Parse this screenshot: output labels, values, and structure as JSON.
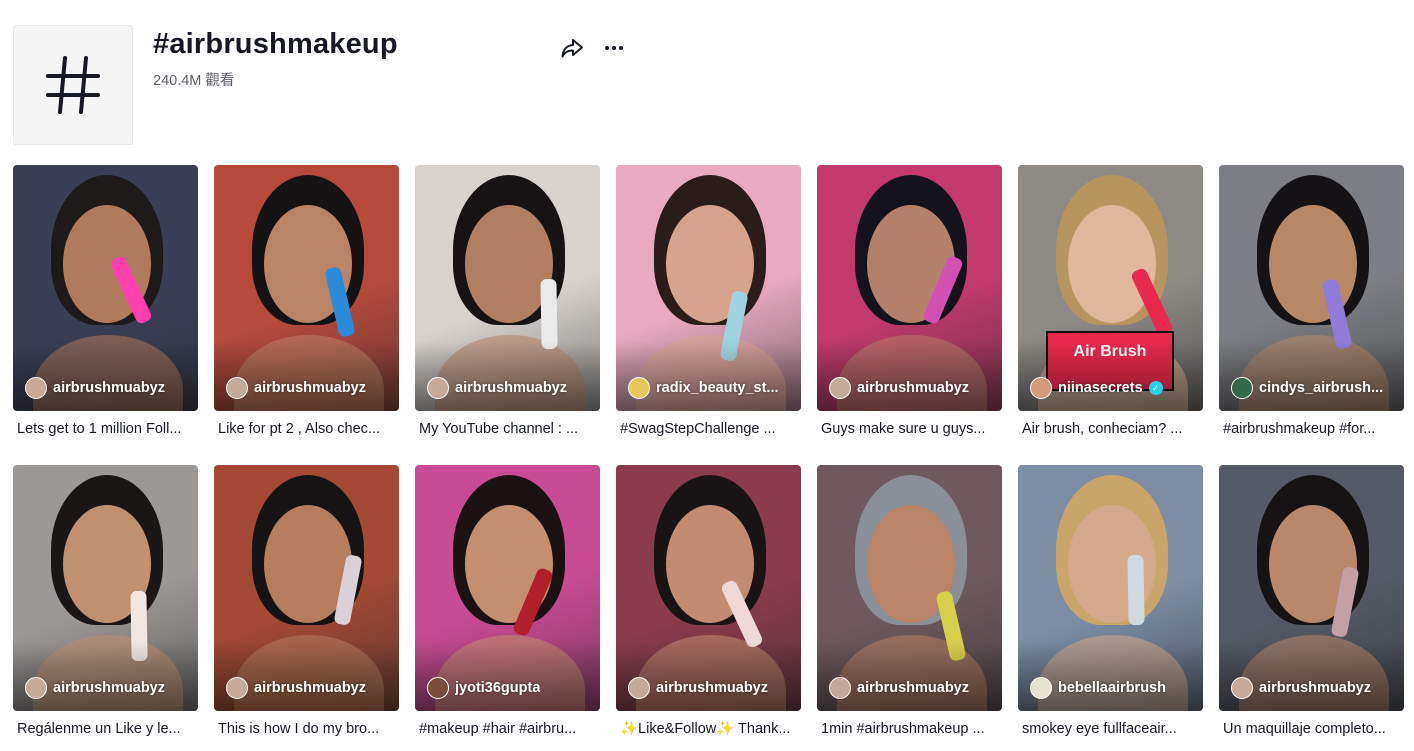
{
  "hashtag": {
    "title": "#airbrushmakeup",
    "views": "240.4M 觀看",
    "icon": "hash-icon"
  },
  "actions": {
    "share_icon": "share-icon",
    "more_icon": "more-icon"
  },
  "videos": [
    {
      "creator": "airbrushmuabyz",
      "caption": "Lets get to 1 million Foll...",
      "bg": "#3a3f55",
      "skin": "#b07a5c",
      "hair": "#1e1a1a",
      "avatar": "#c7a99a",
      "accent": "#ff3fae"
    },
    {
      "creator": "airbrushmuabyz",
      "caption": "Like for pt 2 , Also chec...",
      "bg": "#b84a3c",
      "skin": "#b98366",
      "hair": "#151214",
      "avatar": "#c7a99a",
      "accent": "#2b8ad9"
    },
    {
      "creator": "airbrushmuabyz",
      "caption": "My YouTube channel : ...",
      "bg": "#d8d3cf",
      "skin": "#b17e62",
      "hair": "#171314",
      "avatar": "#c7a99a",
      "accent": "#eaeaea"
    },
    {
      "creator": "radix_beauty_st...",
      "caption": "#SwagStepChallenge ...",
      "bg": "#e9a9c0",
      "skin": "#d7a38d",
      "hair": "#2a1c1a",
      "avatar": "#e9c75a",
      "accent": "#9fd3e0"
    },
    {
      "creator": "airbrushmuabyz",
      "caption": "Guys make sure u guys...",
      "bg": "#c43a6d",
      "skin": "#b5806a",
      "hair": "#14121a",
      "avatar": "#c7a99a",
      "accent": "#d24fb3"
    },
    {
      "creator": "niinasecrets",
      "caption": "Air brush, conheciam? ...",
      "bg": "#8e8a86",
      "skin": "#e0b89c",
      "hair": "#b8955e",
      "avatar": "#d49a7a",
      "accent": "#e8294d",
      "banner": "Air Brush",
      "verified": true
    },
    {
      "creator": "cindys_airbrush...",
      "caption": "#airbrushmakeup #for...",
      "bg": "#7d7f84",
      "skin": "#b78766",
      "hair": "#141214",
      "avatar": "#2f6b4a",
      "accent": "#8f7ad8"
    },
    {
      "creator": "airbrushmuabyz",
      "caption": "Regálenme un Like y le...",
      "bg": "#9c9896",
      "skin": "#c0906f",
      "hair": "#1a1616",
      "avatar": "#c7a99a",
      "accent": "#f0e6e2"
    },
    {
      "creator": "airbrushmuabyz",
      "caption": "This is how I do my bro...",
      "bg": "#a44a34",
      "skin": "#b67d5c",
      "hair": "#161314",
      "avatar": "#c7a99a",
      "accent": "#d9d0d8"
    },
    {
      "creator": "jyoti36gupta",
      "caption": "#makeup #hair #airbru...",
      "bg": "#c94b93",
      "skin": "#c48f6e",
      "hair": "#1a1212",
      "avatar": "#7a4b39",
      "accent": "#b21f2a"
    },
    {
      "creator": "airbrushmuabyz",
      "caption": "✨Like&Follow✨ Thank...",
      "bg": "#8c3b4e",
      "skin": "#c38c70",
      "hair": "#181416",
      "avatar": "#c7a99a",
      "accent": "#f0d8d8"
    },
    {
      "creator": "airbrushmuabyz",
      "caption": "1min #airbrushmakeup ...",
      "bg": "#6e5a5e",
      "skin": "#b88366",
      "hair": "#8a8e96",
      "avatar": "#c7a99a",
      "accent": "#d6cf4a"
    },
    {
      "creator": "bebellaairbrush",
      "caption": "smokey eye fullfaceair...",
      "bg": "#7d8ea4",
      "skin": "#d6a98d",
      "hair": "#c9a56a",
      "avatar": "#e8e2d0",
      "accent": "#cfd9e2"
    },
    {
      "creator": "airbrushmuabyz",
      "caption": "Un maquillaje completo...",
      "bg": "#555a66",
      "skin": "#b9876a",
      "hair": "#171314",
      "avatar": "#c7a99a",
      "accent": "#c2a0a6"
    }
  ]
}
